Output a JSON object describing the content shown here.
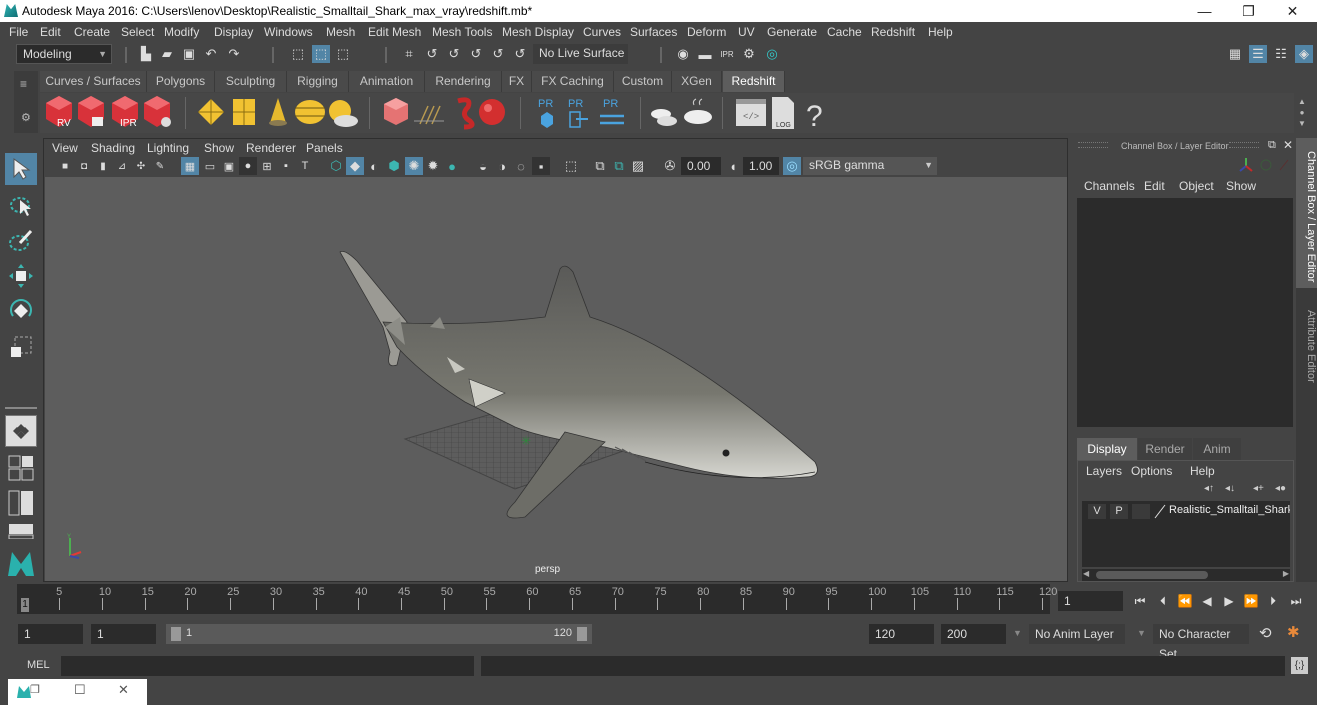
{
  "window": {
    "title": "Autodesk Maya 2016: C:\\Users\\lenov\\Desktop\\Realistic_Smalltail_Shark_max_vray\\redshift.mb*",
    "controls": {
      "minimize": "—",
      "restore": "❐",
      "close": "✕"
    }
  },
  "menubar": [
    "File",
    "Edit",
    "Create",
    "Select",
    "Modify",
    "Display",
    "Windows",
    "Mesh",
    "Edit Mesh",
    "Mesh Tools",
    "Mesh Display",
    "Curves",
    "Surfaces",
    "Deform",
    "UV",
    "Generate",
    "Cache",
    "Redshift",
    "Help"
  ],
  "statusline": {
    "mode": "Modeling",
    "live_surface": "No Live Surface",
    "render_icons": [
      "render-view-icon",
      "render-frame-icon",
      "ipr-render-icon",
      "render-settings-icon",
      "hypershade-icon"
    ]
  },
  "shelf": {
    "tabs": [
      "Curves / Surfaces",
      "Polygons",
      "Sculpting",
      "Rigging",
      "Animation",
      "Rendering",
      "FX",
      "FX Caching",
      "Custom",
      "XGen",
      "Redshift"
    ],
    "active_tab": "Redshift",
    "icons": [
      {
        "name": "redshift-render-view-icon",
        "label": "RV"
      },
      {
        "name": "redshift-batch-render-icon",
        "label": ""
      },
      {
        "name": "redshift-ipr-icon",
        "label": "IPR"
      },
      {
        "name": "redshift-settings-icon",
        "label": ""
      },
      {
        "name": "redshift-light-portal-icon",
        "label": ""
      },
      {
        "name": "redshift-physical-light-icon",
        "label": ""
      },
      {
        "name": "redshift-spot-light-icon",
        "label": ""
      },
      {
        "name": "redshift-dome-light-icon",
        "label": ""
      },
      {
        "name": "redshift-sun-sky-icon",
        "label": ""
      },
      {
        "name": "redshift-proxy-icon",
        "label": ""
      },
      {
        "name": "redshift-hair-icon",
        "label": ""
      },
      {
        "name": "redshift-material-icon",
        "label": ""
      },
      {
        "name": "redshift-sphere-icon",
        "label": ""
      },
      {
        "name": "pr-create-icon",
        "label": "PR"
      },
      {
        "name": "pr-export-icon",
        "label": "PR"
      },
      {
        "name": "pr-sync-icon",
        "label": "PR"
      },
      {
        "name": "bake-multi-icon",
        "label": ""
      },
      {
        "name": "bake-single-icon",
        "label": ""
      },
      {
        "name": "script-editor-icon",
        "label": ""
      },
      {
        "name": "log-icon",
        "label": "LOG"
      },
      {
        "name": "help-icon",
        "label": "?"
      }
    ]
  },
  "viewport": {
    "menu": [
      "View",
      "Shading",
      "Lighting",
      "Show",
      "Renderer",
      "Panels"
    ],
    "exposure": "0.00",
    "gamma": "1.00",
    "color_space": "sRGB gamma",
    "camera_label": "persp",
    "axis": {
      "y": "Y",
      "x": "X",
      "z": "Z"
    }
  },
  "channel_box": {
    "title": "Channel Box / Layer Editor",
    "menu": [
      "Channels",
      "Edit",
      "Object",
      "Show"
    ]
  },
  "layer_editor": {
    "tabs": [
      "Display",
      "Render",
      "Anim"
    ],
    "active_tab": "Display",
    "menu": [
      "Layers",
      "Options",
      "Help"
    ],
    "layers": [
      {
        "v": "V",
        "p": "P",
        "name": "Realistic_Smalltail_Shark"
      }
    ]
  },
  "side_tabs": [
    "Channel Box / Layer Editor",
    "Attribute Editor"
  ],
  "timeline": {
    "ticks": [
      5,
      10,
      15,
      20,
      25,
      30,
      35,
      40,
      45,
      50,
      55,
      60,
      65,
      70,
      75,
      80,
      85,
      90,
      95,
      100,
      105,
      110,
      115,
      120
    ],
    "range_start": 1,
    "range_end": 120,
    "current_frame_marker": "1",
    "current_frame": "1"
  },
  "playback": {
    "buttons": [
      "go-to-start",
      "step-back-key",
      "step-back-frame-key",
      "play-backward",
      "play-forward",
      "step-forward-key",
      "step-forward-frame",
      "go-to-end"
    ]
  },
  "range": {
    "start": "1",
    "playback_start": "1",
    "slider_start": "1",
    "slider_end": "120",
    "playback_end": "120",
    "end": "200",
    "anim_layer": "No Anim Layer",
    "character_set": "No Character Set"
  },
  "commandline": {
    "label": "MEL",
    "value": "",
    "result": ""
  },
  "taskbar": {
    "restore": "❐",
    "maximize": "☐",
    "close": "✕"
  }
}
